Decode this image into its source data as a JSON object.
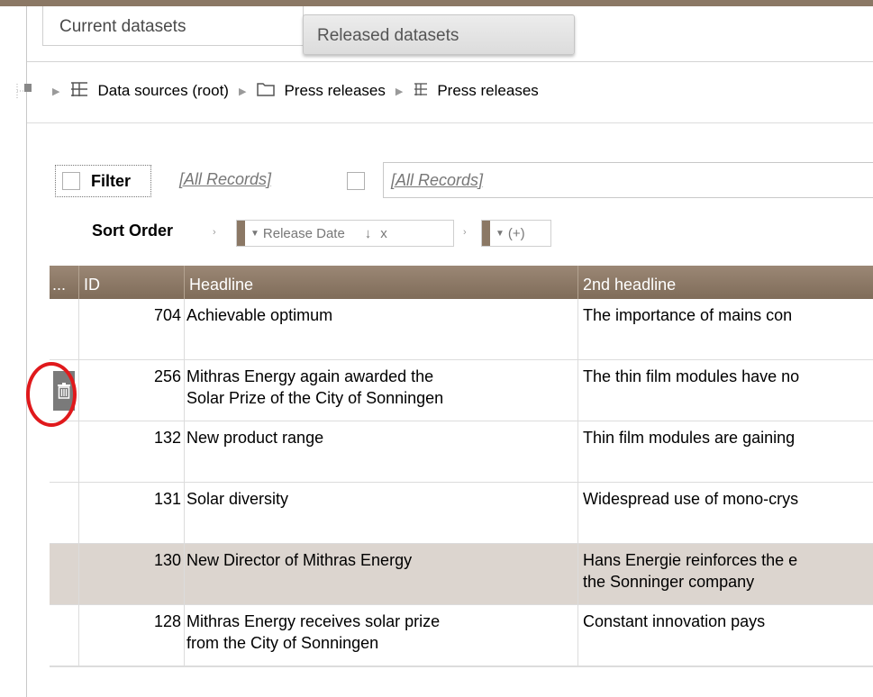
{
  "tabs": {
    "current": "Current datasets",
    "released": "Released datasets"
  },
  "breadcrumb": {
    "items": [
      {
        "icon": "table-icon",
        "label": "Data sources (root)"
      },
      {
        "icon": "folder-icon",
        "label": "Press releases"
      },
      {
        "icon": "table-icon",
        "label": "Press releases"
      }
    ]
  },
  "filter": {
    "label": "Filter",
    "link": "[All Records]",
    "input_value": "[All Records]"
  },
  "sort": {
    "label": "Sort Order",
    "field": "Release Date",
    "direction_symbol": "↓",
    "remove_symbol": "x",
    "add_label": "(+)"
  },
  "table": {
    "columns": [
      "...",
      "ID",
      "Headline",
      "2nd headline"
    ],
    "rows": [
      {
        "id": "704",
        "headline_lines": [
          "Achievable optimum",
          ""
        ],
        "second_lines": [
          "The importance of mains con",
          ""
        ],
        "selected": false
      },
      {
        "id": "256",
        "headline_lines": [
          "Mithras Energy again awarded the",
          "Solar Prize of the City of Sonningen"
        ],
        "second_lines": [
          "The thin film modules have no",
          ""
        ],
        "selected": false,
        "has_delete": true
      },
      {
        "id": "132",
        "headline_lines": [
          "New product range",
          ""
        ],
        "second_lines": [
          "Thin film modules are gaining",
          ""
        ],
        "selected": false
      },
      {
        "id": "131",
        "headline_lines": [
          "Solar diversity",
          ""
        ],
        "second_lines": [
          "Widespread use of mono-crys",
          ""
        ],
        "selected": false
      },
      {
        "id": "130",
        "headline_lines": [
          "New Director of Mithras Energy",
          ""
        ],
        "second_lines": [
          "Hans Energie reinforces the e",
          "the Sonninger company"
        ],
        "selected": true
      },
      {
        "id": "128",
        "headline_lines": [
          "Mithras Energy receives solar prize",
          "from the City of Sonningen"
        ],
        "second_lines": [
          "Constant innovation pays",
          ""
        ],
        "selected": false
      }
    ]
  },
  "colors": {
    "accent_brown": "#8b7865",
    "highlight_red": "#e0191c",
    "selected_row": "#dcd5cf"
  }
}
